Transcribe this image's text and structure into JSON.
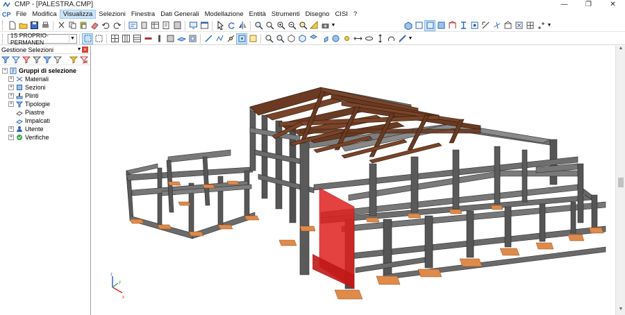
{
  "window": {
    "title": "CMP - [PALESTRA.CMP]",
    "app_icon": "cmp-logo-icon",
    "controls": [
      "minimize-icon",
      "restore-icon",
      "close-icon"
    ]
  },
  "menubar": {
    "logo": "CP",
    "items": [
      "File",
      "Modifica",
      "Visualizza",
      "Selezioni",
      "Finestra",
      "Dati Generali",
      "Modellazione",
      "Entità",
      "Strumenti",
      "Disegno",
      "CISI",
      "?"
    ],
    "active": "Visualizza"
  },
  "toolbar2": {
    "combo_value": "1S PROPRIO-PERMANEN"
  },
  "panel": {
    "title": "Gestione Selezioni",
    "tree_root": "Gruppi di selezione",
    "tree_items": [
      {
        "label": "Materiali",
        "expandable": true,
        "icon": "material-icon"
      },
      {
        "label": "Sezioni",
        "expandable": true,
        "icon": "section-icon"
      },
      {
        "label": "Plinti",
        "expandable": true,
        "icon": "footing-icon"
      },
      {
        "label": "Tipologie",
        "expandable": true,
        "icon": "typology-icon"
      },
      {
        "label": "Piastre",
        "expandable": false,
        "icon": "plate-icon"
      },
      {
        "label": "Impalcati",
        "expandable": false,
        "icon": "floor-icon"
      },
      {
        "label": "Utente",
        "expandable": true,
        "icon": "user-icon"
      },
      {
        "label": "Verifiche",
        "expandable": true,
        "icon": "check-icon"
      }
    ]
  },
  "viewport": {
    "content": "3d-structural-model",
    "colors": {
      "frame": "#6b6b6b",
      "frame_dark": "#3f3f3f",
      "roof_truss": "#6a3a22",
      "foundation": "#e08a4a",
      "selection": "#e02020"
    },
    "axes_icon": "xyz-axes-icon"
  }
}
